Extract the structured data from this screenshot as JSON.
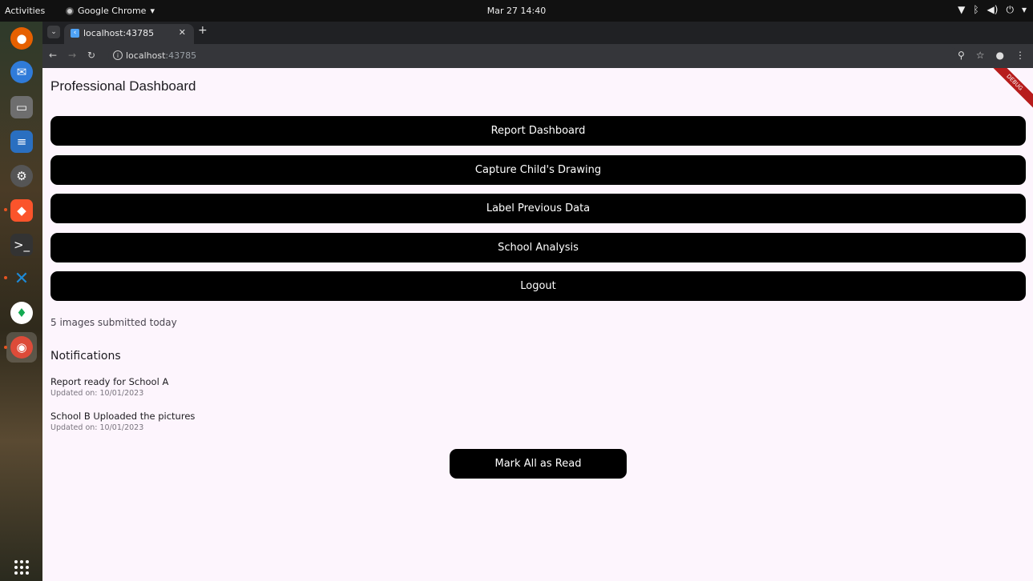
{
  "system": {
    "activities": "Activities",
    "app_name": "Google Chrome",
    "clock": "Mar 27  14:40"
  },
  "browser": {
    "tab_title": "localhost:43785",
    "url_host": "localhost",
    "url_port": ":43785"
  },
  "app": {
    "debug_label": "DEBUG",
    "title": "Professional Dashboard",
    "buttons": [
      {
        "label": "Report Dashboard"
      },
      {
        "label": "Capture Child's Drawing"
      },
      {
        "label": "Label Previous Data"
      },
      {
        "label": "School Analysis"
      },
      {
        "label": "Logout"
      }
    ],
    "submitted_text": "5 images submitted today",
    "notifications_title": "Notifications",
    "notifications": [
      {
        "text": "Report ready for School A",
        "date": "Updated on: 10/01/2023"
      },
      {
        "text": "School B Uploaded the pictures",
        "date": "Updated on: 10/01/2023"
      }
    ],
    "mark_all_label": "Mark All as Read"
  },
  "colors": {
    "button_bg": "#000000",
    "page_bg": "#fdf5fd",
    "debug_banner": "#b71c1c"
  }
}
